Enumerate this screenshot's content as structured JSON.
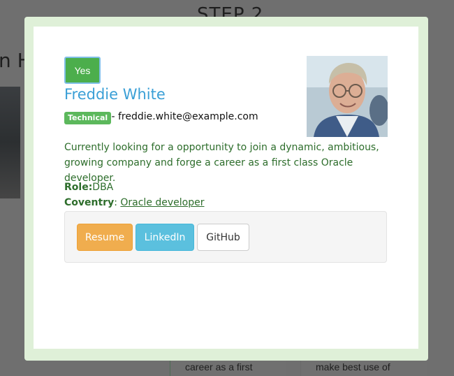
{
  "background": {
    "step_title": "STEP 2",
    "heading_fragment": "n H",
    "card_left_text": "career as a first",
    "card_right_text": "make best use of"
  },
  "modal": {
    "status_button": "Yes",
    "candidate": {
      "name": "Freddie White",
      "tag": "Technical",
      "email_separator": " - ",
      "email": "freddie.white@example.com",
      "bio": "Currently looking for a opportunity to join a dynamic, ambitious, growing company and forge a career as a first class Oracle developer.",
      "role_label": "Role:",
      "role_value": "DBA",
      "location_label": "Coventry",
      "location_separator": ": ",
      "location_link": "Oracle developer",
      "photo": "profile-photo"
    },
    "links": {
      "resume": "Resume",
      "linkedin": "LinkedIn",
      "github": "GitHub"
    }
  },
  "colors": {
    "modal_border": "#dff0d8",
    "name": "#3a9fd6",
    "text_green": "#2d6d2b",
    "yes": "#4cae4c",
    "badge": "#5cb85c",
    "resume": "#f0ad4e",
    "linkedin": "#5bc0de"
  }
}
